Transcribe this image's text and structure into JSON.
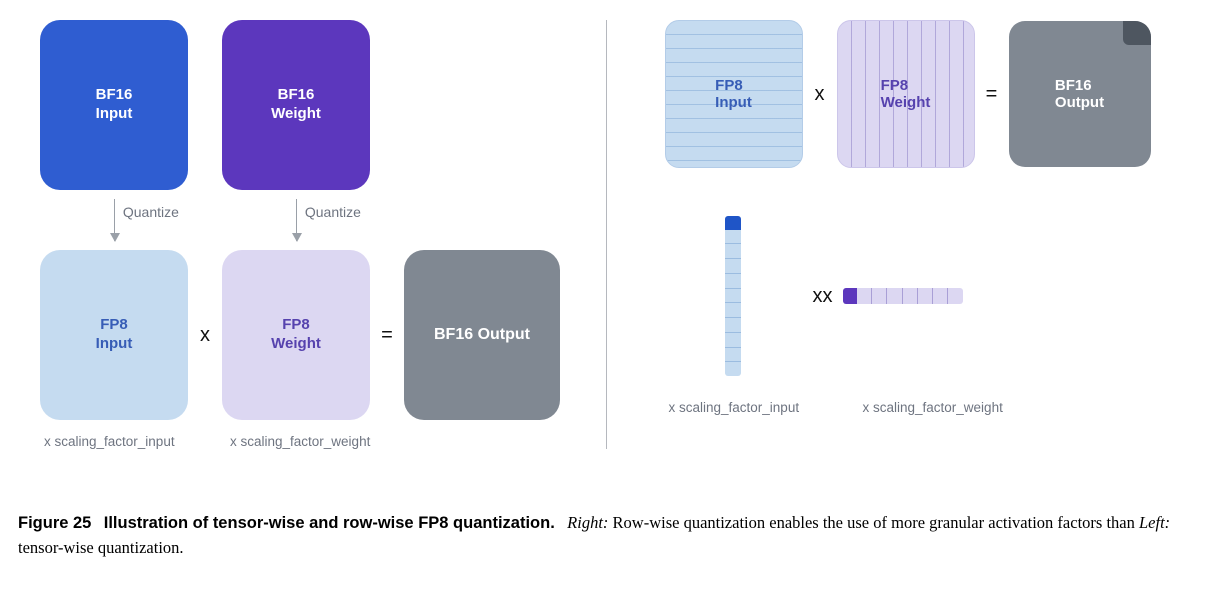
{
  "left": {
    "bf16_input": "BF16\nInput",
    "bf16_weight": "BF16\nWeight",
    "quantize_label": "Quantize",
    "fp8_input": "FP8\nInput",
    "fp8_weight": "FP8\nWeight",
    "bf16_output": "BF16 Output",
    "times": "x",
    "equals": "=",
    "scaling_input": "x scaling_factor_input",
    "scaling_weight": "x scaling_factor_weight"
  },
  "right": {
    "fp8_input": "FP8\nInput",
    "fp8_weight": "FP8\nWeight",
    "bf16_output": "BF16\nOutput",
    "times": "x",
    "equals": "=",
    "scaling_input": "x scaling_factor_input",
    "scaling_weight": "x scaling_factor_weight"
  },
  "caption": {
    "fignum": "Figure 25",
    "title": "Illustration of tensor-wise and row-wise FP8 quantization.",
    "right_label": "Right:",
    "right_text": " Row-wise quantization enables the use of more granular activation factors than ",
    "left_label": "Left:",
    "left_text": " tensor-wise quantization."
  },
  "colors": {
    "bf16_input": "#2f5dd1",
    "bf16_weight": "#5c37bd",
    "fp8_input": "#c5dbf0",
    "fp8_weight": "#dcd7f2",
    "bf16_output": "#808892"
  }
}
